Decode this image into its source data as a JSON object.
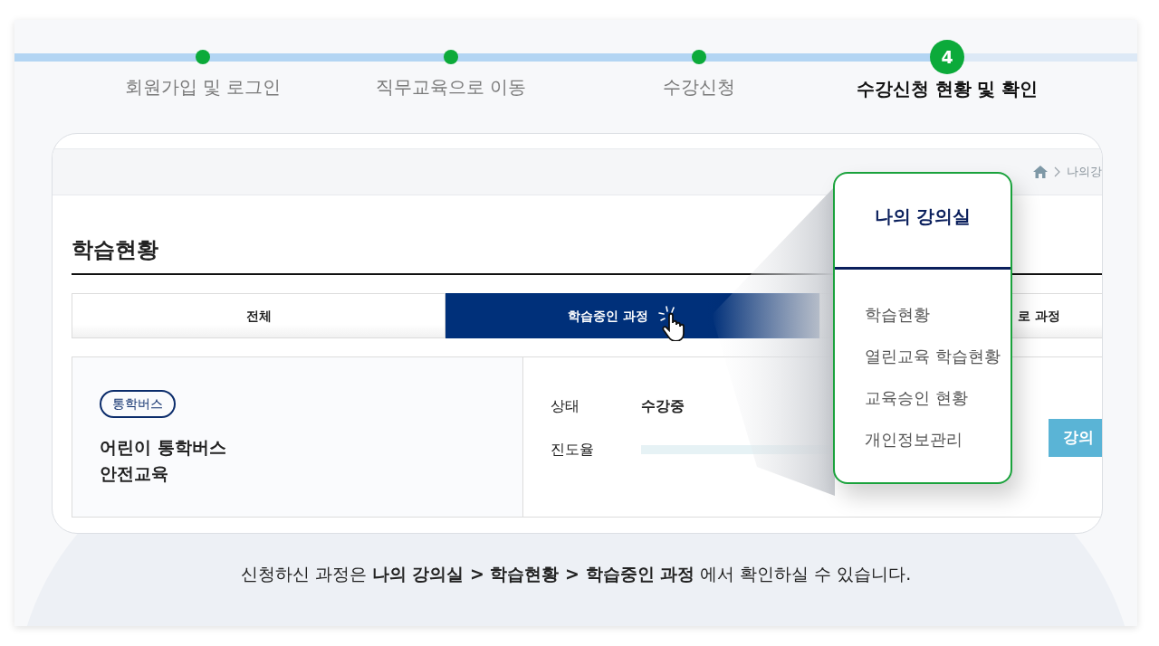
{
  "steps": [
    {
      "label": "회원가입 및 로그인",
      "current": false
    },
    {
      "label": "직무교육으로 이동",
      "current": false
    },
    {
      "label": "수강신청",
      "current": false
    },
    {
      "label": "수강신청 현황 및 확인",
      "current": true,
      "number": "4"
    }
  ],
  "page": {
    "breadcrumb": [
      "나의강"
    ],
    "title": "학습현황",
    "tabs": [
      {
        "label": "전체",
        "selected": false
      },
      {
        "label": "학습중인 과정",
        "selected": true
      },
      {
        "label": "로 과정",
        "selected": false
      }
    ],
    "course": {
      "tag": "통학버스",
      "name": "어린이 통학버스\n안전교육",
      "fields": [
        {
          "label": "상태",
          "value": "수강중",
          "kind": "text"
        },
        {
          "label": "진도율",
          "kind": "progress"
        }
      ],
      "button": "강의"
    }
  },
  "popup": {
    "title": "나의 강의실",
    "items": [
      "학습현황",
      "열린교육 학습현황",
      "교육승인 현황",
      "개인정보관리"
    ]
  },
  "caption": "신청하신 과정은 **나의 강의실 > 학습현황 > 학습중인 과정** 에서 확인하실 수 있습니다."
}
